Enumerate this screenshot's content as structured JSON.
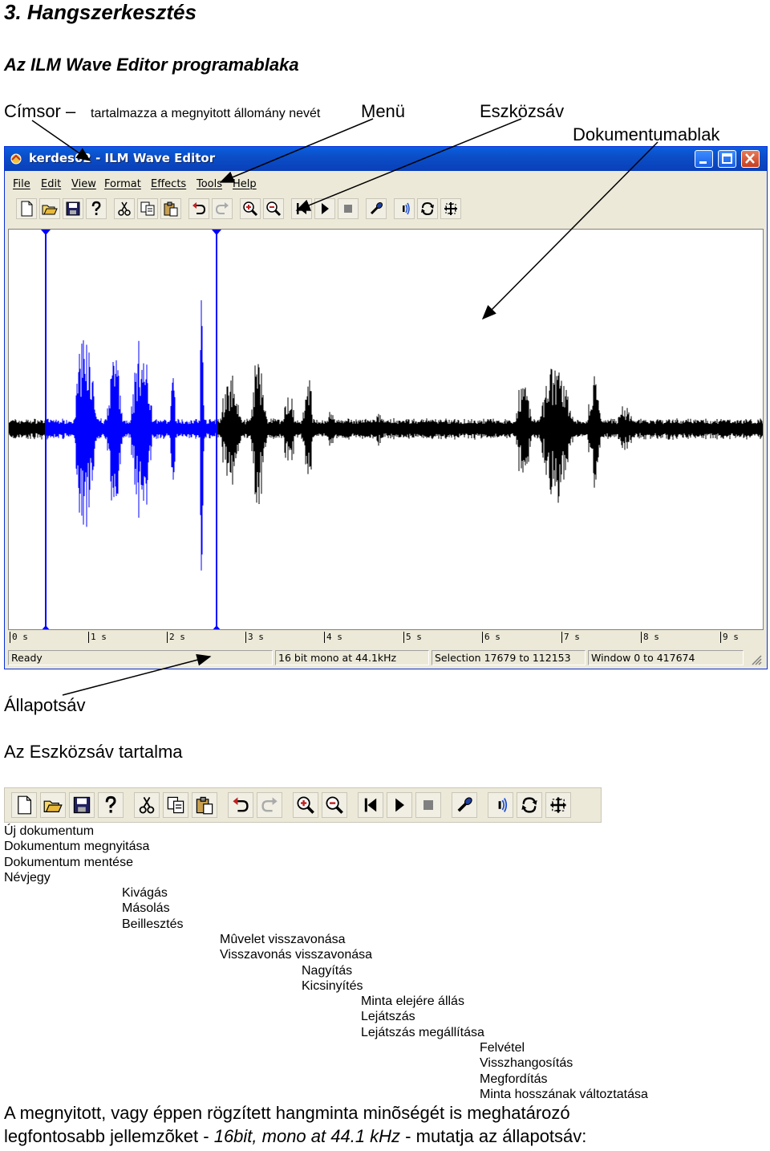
{
  "heading": "3. Hangszerkesztés",
  "subheading": "Az ILM Wave Editor programablaka",
  "labels": {
    "cimsor": "Címsor –",
    "cimsor_desc": "tartalmazza a megnyitott állomány nevét",
    "menu": "Menü",
    "eszkozsav": "Eszközsáv",
    "dokumentumablak": "Dokumentumablak",
    "allapotsav": "Állapotsáv",
    "eszkozsav_tartalma": "Az Eszközsáv tartalma"
  },
  "window": {
    "title": "kerdes02 - ILM Wave Editor",
    "menu": [
      "File",
      "Edit",
      "View",
      "Format",
      "Effects",
      "Tools",
      "Help"
    ],
    "ruler_ticks": [
      "0 s",
      "1 s",
      "2 s",
      "3 s",
      "4 s",
      "5 s",
      "6 s",
      "7 s",
      "8 s",
      "9 s"
    ],
    "status": {
      "ready": "Ready",
      "format": "16 bit mono at 44.1kHz",
      "selection": "Selection 17679 to 112153",
      "window": "Window 0 to 417674"
    },
    "colors": {
      "titlebar": "#0a4fc7",
      "selection_wave": "#0000ff",
      "wave": "#000000"
    }
  },
  "toolbar_icons": [
    "new-icon",
    "open-icon",
    "save-icon",
    "about-icon",
    "cut-icon",
    "copy-icon",
    "paste-icon",
    "undo-icon",
    "redo-icon",
    "zoom-in-icon",
    "zoom-out-icon",
    "rewind-icon",
    "play-icon",
    "stop-icon",
    "record-icon",
    "echo-icon",
    "reverse-icon",
    "resize-icon"
  ],
  "legend": {
    "group1": [
      "Új dokumentum",
      "Dokumentum megnyitása",
      "Dokumentum mentése",
      "Névjegy"
    ],
    "group2": [
      "Kivágás",
      "Másolás",
      "Beillesztés"
    ],
    "group3": [
      "Mûvelet visszavonása",
      "Visszavonás visszavonása"
    ],
    "group4": [
      "Nagyítás",
      "Kicsinyítés"
    ],
    "group5": [
      "Minta elejére állás",
      "Lejátszás",
      "Lejátszás megállítása"
    ],
    "group6": [
      "Felvétel",
      "Visszhangosítás",
      "Megfordítás",
      "Minta hosszának változtatása"
    ]
  },
  "footer": {
    "line1": "A megnyitott, vagy éppen rögzített hangminta minõségét is meghatározó",
    "line2_a": "legfontosabb jellemzõket - ",
    "line2_b": "16bit, mono at 44.1 kHz",
    "line2_c": " - mutatja az állapotsáv:"
  }
}
